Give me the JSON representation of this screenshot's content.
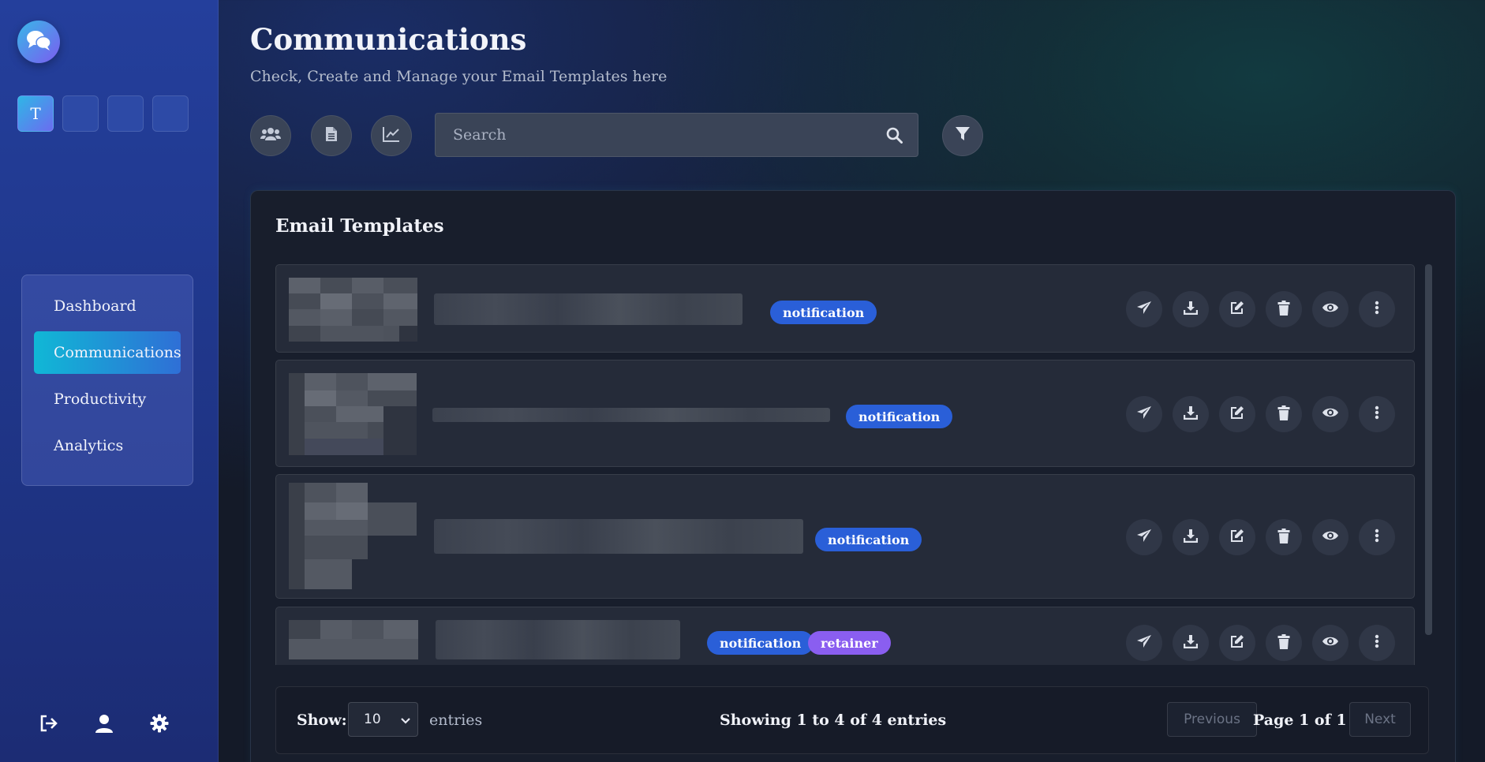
{
  "sidebar": {
    "logo_icon": "chat-bubbles-icon",
    "workspaces": [
      "T",
      "",
      "",
      ""
    ],
    "nav": [
      "Dashboard",
      "Communications",
      "Productivity",
      "Analytics"
    ],
    "active_nav": "Communications",
    "bottom_icons": [
      "logout-icon",
      "user-icon",
      "gear-icon"
    ]
  },
  "header": {
    "title": "Communications",
    "subtitle": "Check, Create and Manage your Email Templates here"
  },
  "toolbar": {
    "icons": [
      "users-icon",
      "document-icon",
      "chart-line-icon"
    ],
    "search_placeholder": "Search",
    "filter_icon": "filter-icon"
  },
  "templates": {
    "title": "Email Templates",
    "rows": [
      {
        "tags": [
          "notification"
        ]
      },
      {
        "tags": [
          "notification"
        ]
      },
      {
        "tags": [
          "notification"
        ]
      },
      {
        "tags": [
          "notification",
          "retainer"
        ]
      }
    ],
    "row_actions": [
      "send-icon",
      "download-icon",
      "edit-icon",
      "trash-icon",
      "eye-icon",
      "more-vertical-icon"
    ]
  },
  "footer": {
    "show_label": "Show:",
    "page_size": "10",
    "entries_label": "entries",
    "showing": "Showing 1 to 4 of 4 entries",
    "previous": "Previous",
    "page_info": "Page 1 of 1",
    "next": "Next"
  },
  "colors": {
    "sidebar": "#243f9c",
    "active_nav": "#10b8d6",
    "badge_notification": "#2a5fd8",
    "badge_retainer": "#8a5ef0"
  }
}
